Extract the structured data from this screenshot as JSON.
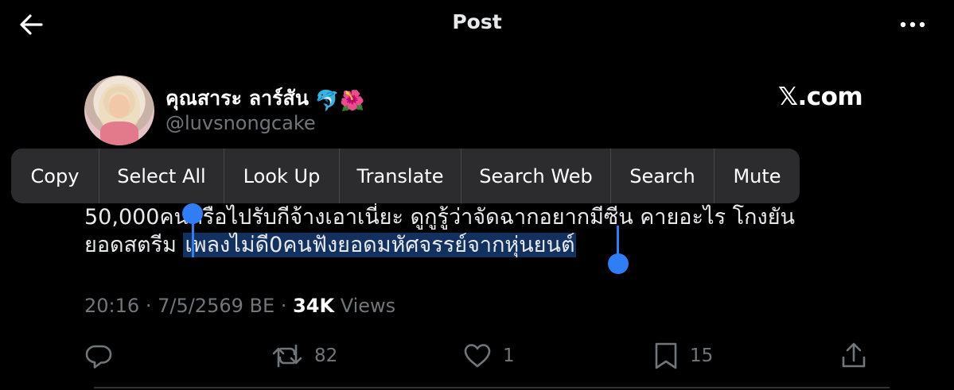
{
  "header": {
    "title": "Post",
    "back_icon": "arrow-left-icon",
    "more_icon": "more-horizontal-icon"
  },
  "author": {
    "name": "คุณสาระ ลาร์สัน",
    "emoji": "🐬🌺",
    "handle": "@luvsnongcake",
    "badge": "𝕏.com"
  },
  "context_menu": {
    "items": [
      "Copy",
      "Select All",
      "Look Up",
      "Translate",
      "Search Web",
      "Search",
      "Mute"
    ]
  },
  "tweet": {
    "line1": "50,000คนหรือไปรับกีจ้างเอาเนี่ยะ ดูกูรู้ว่าจัดฉากอยากมีซีน คายอะไร โกงยัน",
    "line2_prefix": "ยอดสตรีม ",
    "line2_selected": "เพลงไม่ดี0คนฟังยอดมหัศจรรย์จากหุ่นยนต์"
  },
  "meta": {
    "time": "20:16",
    "sep1": "·",
    "date": "7/5/2569 BE",
    "sep2": "·",
    "views_count": "34K",
    "views_label": "Views"
  },
  "actions": {
    "reply_icon": "reply-icon",
    "retweet_icon": "retweet-icon",
    "retweets": "82",
    "like_icon": "heart-icon",
    "likes": "1",
    "bookmark_icon": "bookmark-icon",
    "bookmarks": "15",
    "share_icon": "share-icon"
  },
  "colors": {
    "background": "#000000",
    "secondary_text": "#71767b",
    "selection": "#13315f",
    "selection_handle": "#2f7ef5",
    "menu_bg": "#2c2c2e"
  }
}
